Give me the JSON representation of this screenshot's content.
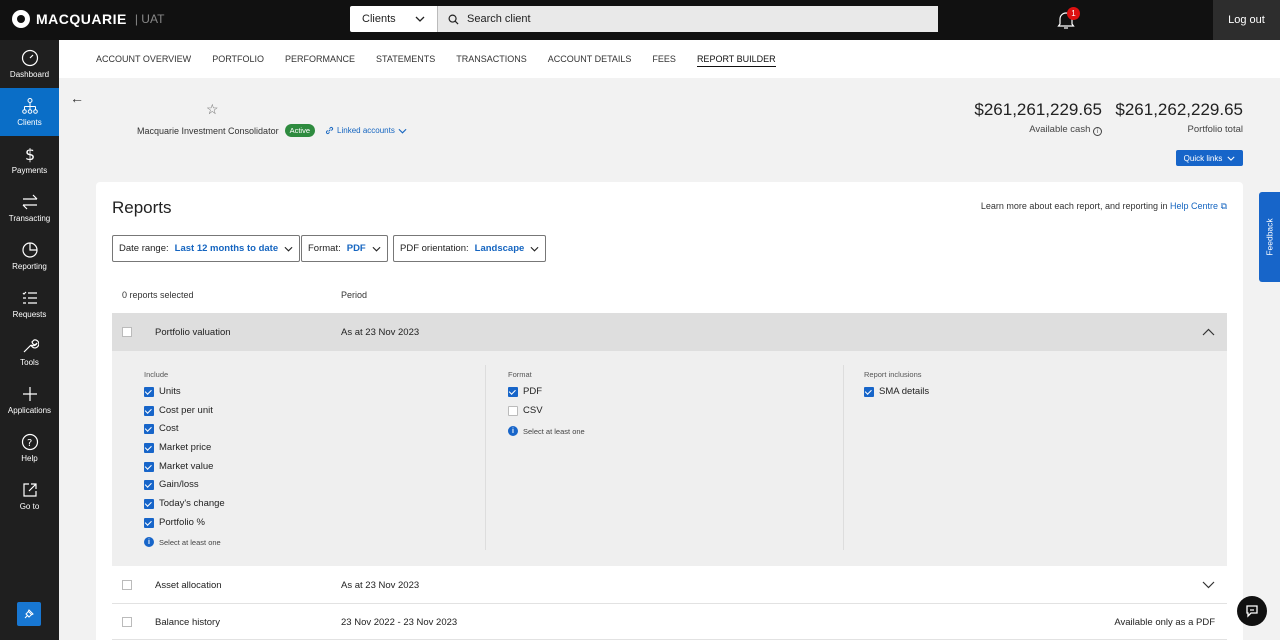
{
  "topbar": {
    "brand": "MACQUARIE",
    "env": "UAT",
    "client_select": "Clients",
    "search_placeholder": "Search client",
    "notification_count": "1",
    "logout": "Log out"
  },
  "sidebar": {
    "items": [
      {
        "label": "Dashboard",
        "icon": "gauge-icon"
      },
      {
        "label": "Clients",
        "icon": "org-chart-icon"
      },
      {
        "label": "Payments",
        "icon": "dollar-icon"
      },
      {
        "label": "Transacting",
        "icon": "transfer-arrows-icon"
      },
      {
        "label": "Reporting",
        "icon": "pie-chart-icon"
      },
      {
        "label": "Requests",
        "icon": "checklist-icon"
      },
      {
        "label": "Tools",
        "icon": "wrench-icon"
      },
      {
        "label": "Applications",
        "icon": "plus-icon"
      },
      {
        "label": "Help",
        "icon": "question-icon"
      },
      {
        "label": "Go to",
        "icon": "external-link-icon"
      }
    ]
  },
  "tabs": [
    "ACCOUNT OVERVIEW",
    "PORTFOLIO",
    "PERFORMANCE",
    "STATEMENTS",
    "TRANSACTIONS",
    "ACCOUNT DETAILS",
    "FEES",
    "REPORT BUILDER"
  ],
  "account": {
    "name": "Macquarie Investment Consolidator",
    "status": "Active",
    "linked": "Linked accounts",
    "available_cash": "$261,261,229.65",
    "available_cash_label": "Available cash",
    "portfolio_total": "$261,262,229.65",
    "portfolio_total_label": "Portfolio total",
    "quick_links": "Quick links"
  },
  "reports": {
    "title": "Reports",
    "learn_text": "Learn more about each report, and reporting in",
    "learn_link": "Help Centre",
    "filters": {
      "date_label": "Date range:",
      "date_value": "Last 12 months to date",
      "format_label": "Format:",
      "format_value": "PDF",
      "orient_label": "PDF orientation:",
      "orient_value": "Landscape"
    },
    "selected_count": "0 reports selected",
    "period_header": "Period",
    "rows": [
      {
        "name": "Portfolio valuation",
        "period": "As at 23 Nov 2023",
        "note": ""
      },
      {
        "name": "Asset allocation",
        "period": "As at 23 Nov 2023",
        "note": ""
      },
      {
        "name": "Balance history",
        "period": "23 Nov 2022 - 23 Nov 2023",
        "note": "Available only as a PDF"
      }
    ],
    "expanded": {
      "include_label": "Include",
      "include_items": [
        "Units",
        "Cost per unit",
        "Cost",
        "Market price",
        "Market value",
        "Gain/loss",
        "Today's change",
        "Portfolio %"
      ],
      "include_hint": "Select at least one",
      "format_label": "Format",
      "format_pdf": "PDF",
      "format_csv": "CSV",
      "format_hint": "Select at least one",
      "inclusions_label": "Report inclusions",
      "inclusions_item": "SMA details"
    }
  },
  "feedback": "Feedback"
}
